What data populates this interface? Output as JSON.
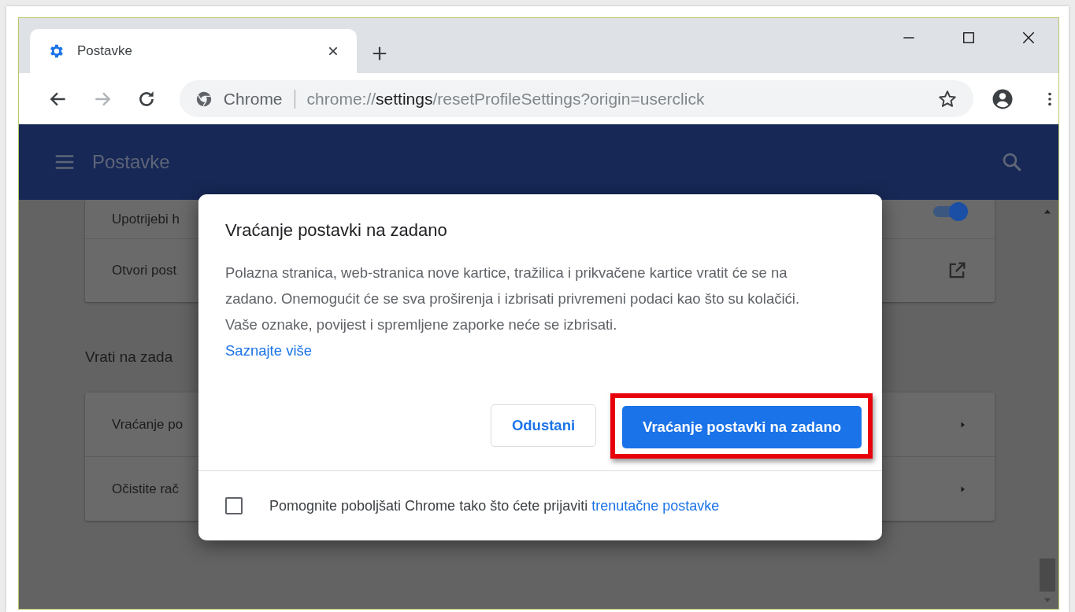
{
  "tabs": [
    {
      "title": "Postavke",
      "selected": true
    }
  ],
  "address_bar": {
    "site_label": "Chrome",
    "url_scheme": "chrome://",
    "url_host": "settings",
    "url_path": "/resetProfileSettings?origin=userclick"
  },
  "header": {
    "title": "Postavke"
  },
  "settings": {
    "top_rows": [
      {
        "label": "Upotrijebi h",
        "kind": "toggle",
        "on": true
      },
      {
        "label": "Otvori post",
        "kind": "external"
      }
    ],
    "section_title": "Vrati na zada",
    "bottom_rows": [
      {
        "label": "Vraćanje po",
        "kind": "arrow"
      },
      {
        "label": "Očistite rač",
        "kind": "arrow"
      }
    ]
  },
  "dialog": {
    "title": "Vraćanje postavki na zadano",
    "body": "Polazna stranica, web-stranica nove kartice, tražilica i prikvačene kartice vratit će se na zadano. Onemogućit će se sva proširenja i izbrisati privremeni podaci kao što su kolačići. Vaše oznake, povijest i spremljene zaporke neće se izbrisati.",
    "link": "Saznajte više",
    "buttons": [
      {
        "label": "Odustani",
        "kind": "secondary",
        "highlighted": false
      },
      {
        "label": "Vraćanje postavki na zadano",
        "kind": "primary",
        "highlighted": true
      }
    ],
    "footer": {
      "checked": false,
      "text": "Pomognite poboljšati Chrome tako što ćete prijaviti",
      "link": "trenutačne postavke"
    }
  }
}
